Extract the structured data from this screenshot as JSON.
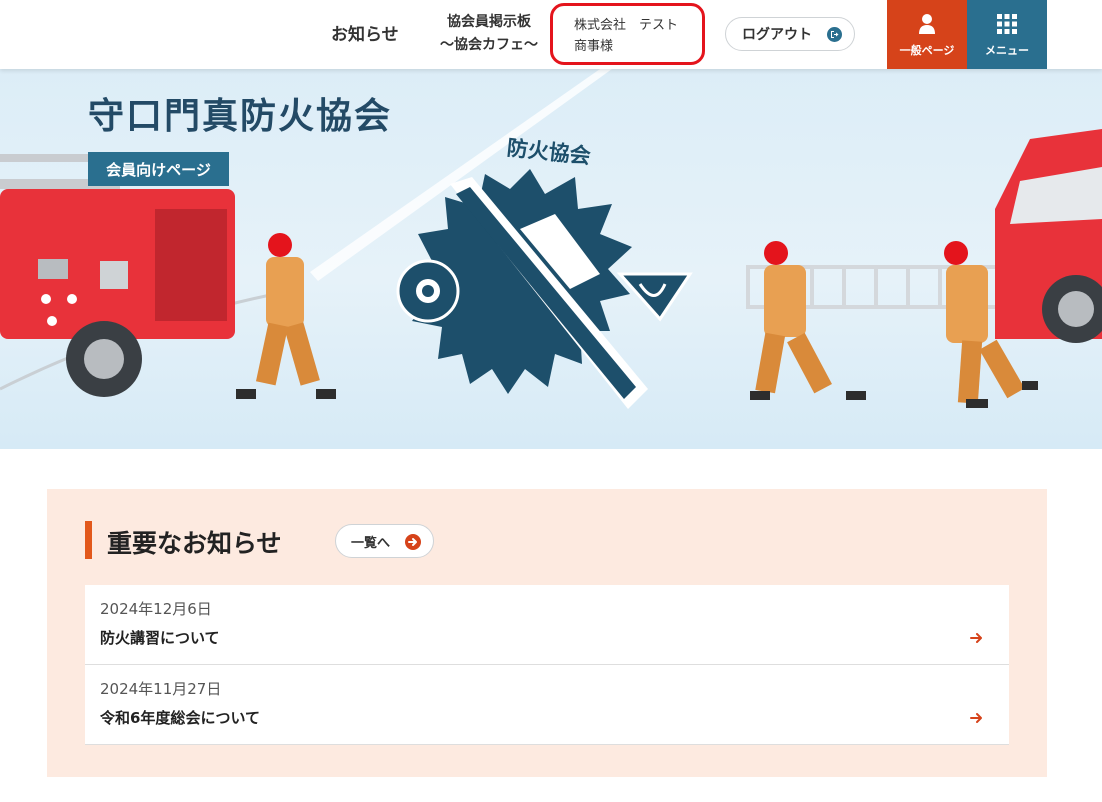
{
  "header": {
    "nav_news": "お知らせ",
    "nav_board_line1": "協会員掲示板",
    "nav_board_line2": "〜協会カフェ〜",
    "user_line1": "株式会社　テスト",
    "user_line2": "商事様",
    "logout_label": "ログアウト",
    "general_page_label": "一般ページ",
    "menu_label": "メニュー"
  },
  "hero": {
    "site_title": "守口門真防火協会",
    "member_badge": "会員向けページ",
    "emblem_text": "防火協会"
  },
  "notices": {
    "title": "重要なお知らせ",
    "list_button": "一覧へ",
    "items": [
      {
        "date": "2024年12月6日",
        "title": "防火講習について"
      },
      {
        "date": "2024年11月27日",
        "title": "令和6年度総会について"
      }
    ]
  },
  "colors": {
    "accent_orange": "#d6431a",
    "brand_blue": "#2a6f8f",
    "title_navy": "#234a66",
    "highlight_red": "#e4141c"
  },
  "icons": [
    "logout-icon",
    "person-icon",
    "grid-menu-icon",
    "arrow-right-icon"
  ]
}
